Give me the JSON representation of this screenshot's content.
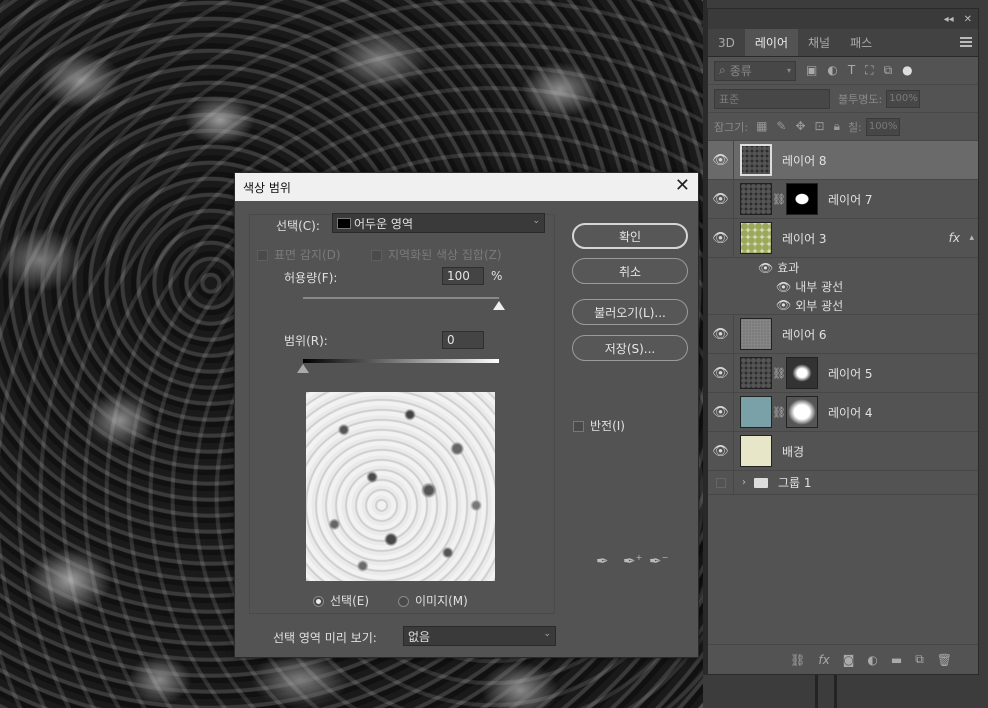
{
  "panel": {
    "tabs": [
      "3D",
      "레이어",
      "채널",
      "패스"
    ],
    "active_tab": "레이어",
    "filter_kind": "종류",
    "blend_mode": "표준",
    "opacity_label": "불투명도:",
    "opacity_value": "100%",
    "lock_label": "잠그기:",
    "fill_label": "칠:",
    "fill_value": "100%",
    "layers": [
      {
        "name": "레이어 8",
        "selected": true,
        "visible": true,
        "mask": false,
        "thumb": "#2b2b2b"
      },
      {
        "name": "레이어 7",
        "selected": false,
        "visible": true,
        "mask": true,
        "thumb": "#2b2b2b"
      },
      {
        "name": "레이어 3",
        "selected": false,
        "visible": true,
        "mask": false,
        "fx": true,
        "thumb": "#7b8a4a"
      },
      {
        "name": "레이어 6",
        "selected": false,
        "visible": true,
        "mask": false,
        "thumb": "#777777"
      },
      {
        "name": "레이어 5",
        "selected": false,
        "visible": true,
        "mask": true,
        "thumb": "#2b2b2b"
      },
      {
        "name": "레이어 4",
        "selected": false,
        "visible": true,
        "mask": true,
        "thumb": "#7aa0a8"
      },
      {
        "name": "배경",
        "selected": false,
        "visible": true,
        "mask": false,
        "thumb": "#e8e6c9"
      }
    ],
    "effects_label": "효과",
    "effects": [
      "내부 광선",
      "외부 광선"
    ],
    "group_name": "그룹 1",
    "fx_label": "fx"
  },
  "dialog": {
    "title": "색상 범위",
    "select_label": "선택(C):",
    "select_value": "어두운 영역",
    "detect_faces": "표면 감지(D)",
    "localized": "지역화된 색상 집합(Z)",
    "fuzziness_label": "허용량(F):",
    "fuzziness_value": "100",
    "fuzziness_unit": "%",
    "fuzziness_level": 1.0,
    "range_label": "범위(R):",
    "range_value": "0",
    "range_level": 0.0,
    "radio_selection": "선택(E)",
    "radio_image": "이미지(M)",
    "preview_label": "선택 영역 미리 보기:",
    "preview_value": "없음",
    "ok": "확인",
    "cancel": "취소",
    "load": "불러오기(L)...",
    "save": "저장(S)...",
    "invert": "반전(I)"
  }
}
